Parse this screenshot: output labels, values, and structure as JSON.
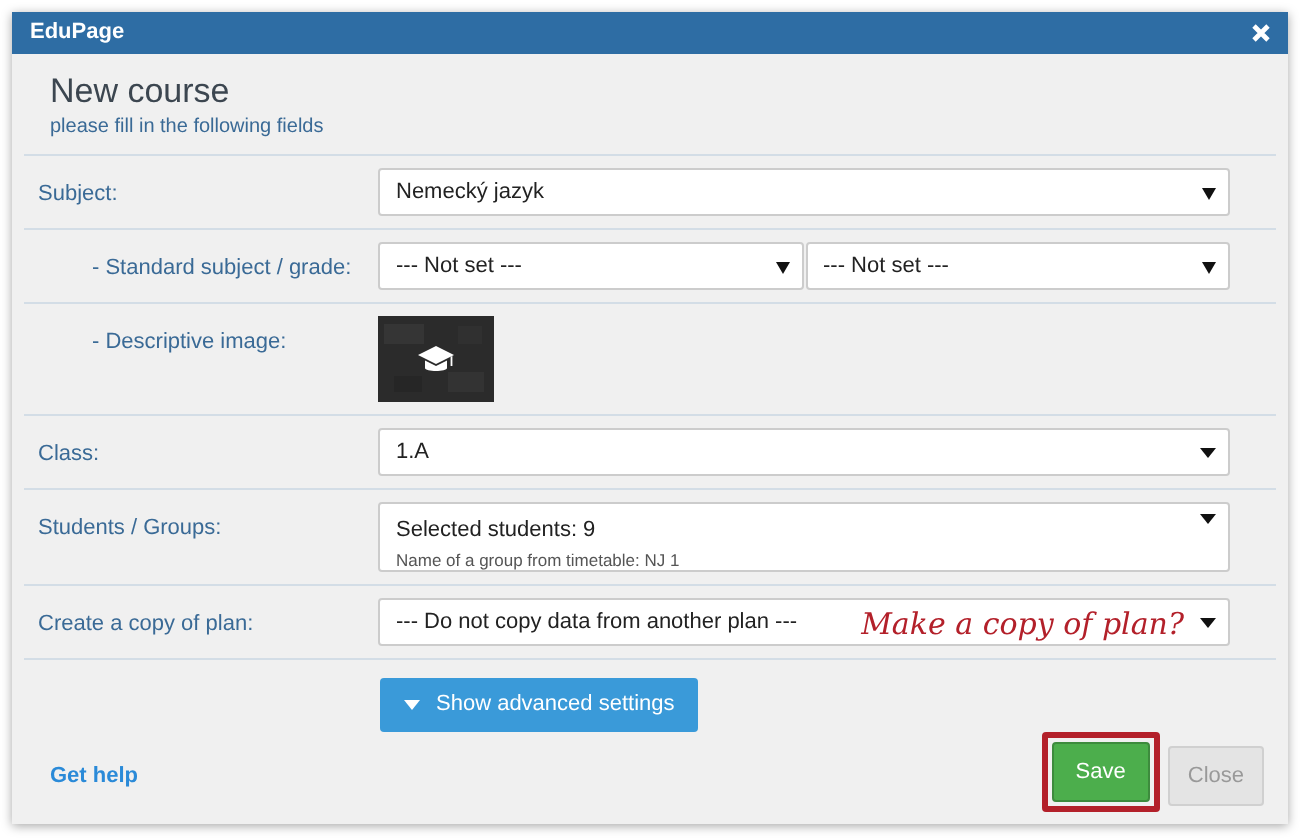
{
  "window": {
    "title": "EduPage"
  },
  "header": {
    "title": "New course",
    "subtitle": "please fill in the following fields"
  },
  "fields": [
    {
      "label": "Subject:",
      "kind": "native-select",
      "value": "Nemecký jazyk",
      "children": [
        {
          "label": "- Standard subject / grade:",
          "kind": "double",
          "values": [
            "--- Not set ---",
            "--- Not set ---"
          ]
        },
        {
          "label": "- Descriptive image:"
        }
      ]
    },
    {
      "label": "Class:",
      "kind": "select",
      "value": "1.A"
    },
    {
      "label": "Students / Groups:",
      "kind": "select",
      "value": "Selected students: 9",
      "note": "Name of a group from timetable: NJ 1"
    },
    {
      "label": "Create a copy of plan:",
      "kind": "select",
      "value": "--- Do not copy data from another plan ---",
      "annotation": "Make a copy of plan?"
    }
  ],
  "advanced_button": "Show advanced settings",
  "help_link": "Get help",
  "buttons": [
    {
      "label": "Save",
      "kind": "primary",
      "highlighted": true
    },
    {
      "label": "Close",
      "kind": "secondary",
      "highlighted": false
    }
  ]
}
